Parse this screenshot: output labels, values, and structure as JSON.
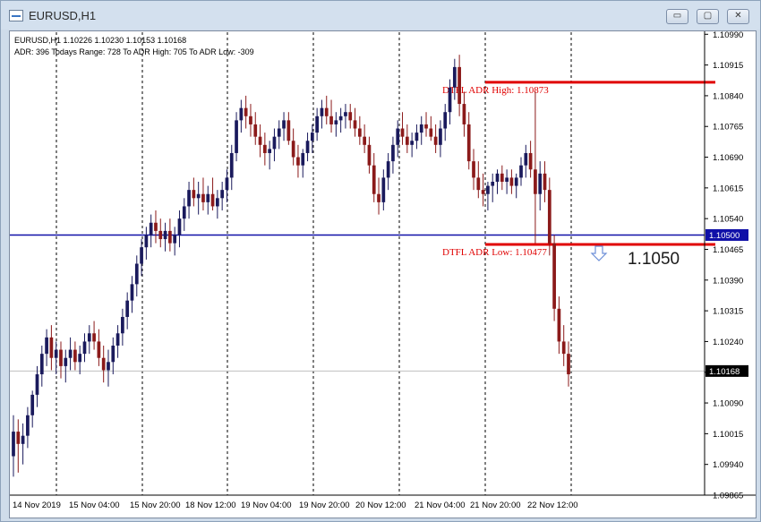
{
  "window": {
    "title": "EURUSD,H1",
    "buttons": {
      "minimize": "▭",
      "maximize": "▢",
      "close": "✕"
    }
  },
  "header": {
    "line1": "EURUSD,H1  1.10226 1.10230 1.10153 1.10168",
    "line2": "ADR: 396  Todays Range: 728  To ADR High: 705  To ADR Low: -309"
  },
  "annotations": {
    "adr_high_label": "DTFL ADR High: 1.10873",
    "adr_low_label": "DTFL ADR Low: 1.10477",
    "big_price": "1.1050"
  },
  "chart_data": {
    "type": "candlestick",
    "symbol": "EURUSD",
    "timeframe": "H1",
    "x_labels": [
      "14 Nov 2019",
      "15 Nov 04:00",
      "15 Nov 20:00",
      "18 Nov 12:00",
      "19 Nov 04:00",
      "19 Nov 20:00",
      "20 Nov 12:00",
      "21 Nov 04:00",
      "21 Nov 20:00",
      "22 Nov 12:00"
    ],
    "y_ticks": [
      1.09865,
      1.0994,
      1.10015,
      1.1009,
      1.10165,
      1.1024,
      1.10315,
      1.1039,
      1.10465,
      1.1054,
      1.10615,
      1.1069,
      1.10765,
      1.1084,
      1.10915,
      1.1099
    ],
    "ylim": [
      1.09865,
      1.10995
    ],
    "ohlc": [
      [
        1.0996,
        1.1006,
        1.0991,
        1.1002
      ],
      [
        1.1002,
        1.1005,
        1.0992,
        1.0999
      ],
      [
        1.0999,
        1.1004,
        1.0994,
        1.1001
      ],
      [
        1.1001,
        1.1008,
        1.0998,
        1.1006
      ],
      [
        1.1006,
        1.1012,
        1.1003,
        1.1011
      ],
      [
        1.1011,
        1.1018,
        1.1008,
        1.1016
      ],
      [
        1.1016,
        1.1023,
        1.1013,
        1.1021
      ],
      [
        1.1021,
        1.1027,
        1.1018,
        1.1025
      ],
      [
        1.1025,
        1.1028,
        1.1017,
        1.102
      ],
      [
        1.102,
        1.1024,
        1.1016,
        1.1022
      ],
      [
        1.1022,
        1.1024,
        1.1015,
        1.1018
      ],
      [
        1.1018,
        1.1022,
        1.1014,
        1.102
      ],
      [
        1.102,
        1.1025,
        1.1017,
        1.1022
      ],
      [
        1.1022,
        1.1024,
        1.1017,
        1.1019
      ],
      [
        1.1019,
        1.1023,
        1.1016,
        1.1021
      ],
      [
        1.1021,
        1.1026,
        1.1019,
        1.1024
      ],
      [
        1.1024,
        1.1028,
        1.1021,
        1.1026
      ],
      [
        1.1026,
        1.1029,
        1.1022,
        1.1024
      ],
      [
        1.1024,
        1.1027,
        1.1018,
        1.102
      ],
      [
        1.102,
        1.1023,
        1.1014,
        1.1017
      ],
      [
        1.1017,
        1.1022,
        1.1013,
        1.1019
      ],
      [
        1.1019,
        1.1025,
        1.1016,
        1.1023
      ],
      [
        1.1023,
        1.1028,
        1.102,
        1.1026
      ],
      [
        1.1026,
        1.1032,
        1.1023,
        1.103
      ],
      [
        1.103,
        1.1036,
        1.1027,
        1.1034
      ],
      [
        1.1034,
        1.104,
        1.1031,
        1.1038
      ],
      [
        1.1038,
        1.1045,
        1.1035,
        1.1043
      ],
      [
        1.1043,
        1.1049,
        1.104,
        1.1047
      ],
      [
        1.1047,
        1.1052,
        1.1044,
        1.105
      ],
      [
        1.105,
        1.1055,
        1.1047,
        1.1053
      ],
      [
        1.1053,
        1.1056,
        1.1048,
        1.1051
      ],
      [
        1.1051,
        1.1054,
        1.1047,
        1.1049
      ],
      [
        1.1049,
        1.1053,
        1.1046,
        1.1051
      ],
      [
        1.1051,
        1.1054,
        1.1046,
        1.1048
      ],
      [
        1.1048,
        1.1052,
        1.1045,
        1.105
      ],
      [
        1.105,
        1.1056,
        1.1047,
        1.1054
      ],
      [
        1.1054,
        1.1059,
        1.1051,
        1.1057
      ],
      [
        1.1057,
        1.1063,
        1.1054,
        1.1061
      ],
      [
        1.1061,
        1.1064,
        1.1057,
        1.1059
      ],
      [
        1.1059,
        1.1063,
        1.1055,
        1.106
      ],
      [
        1.106,
        1.1064,
        1.1056,
        1.1058
      ],
      [
        1.1058,
        1.1062,
        1.1055,
        1.106
      ],
      [
        1.106,
        1.1064,
        1.1056,
        1.1057
      ],
      [
        1.1057,
        1.1061,
        1.1054,
        1.1059
      ],
      [
        1.1059,
        1.1063,
        1.1056,
        1.1061
      ],
      [
        1.1061,
        1.1066,
        1.1058,
        1.1064
      ],
      [
        1.1064,
        1.1072,
        1.1061,
        1.107
      ],
      [
        1.107,
        1.108,
        1.1068,
        1.1078
      ],
      [
        1.1078,
        1.1083,
        1.1075,
        1.1081
      ],
      [
        1.1081,
        1.1084,
        1.1076,
        1.1079
      ],
      [
        1.1079,
        1.1082,
        1.1074,
        1.1077
      ],
      [
        1.1077,
        1.108,
        1.1072,
        1.1074
      ],
      [
        1.1074,
        1.1077,
        1.1069,
        1.1072
      ],
      [
        1.1072,
        1.1075,
        1.1067,
        1.107
      ],
      [
        1.107,
        1.1073,
        1.1066,
        1.1071
      ],
      [
        1.1071,
        1.1076,
        1.1068,
        1.1074
      ],
      [
        1.1074,
        1.1078,
        1.1071,
        1.1076
      ],
      [
        1.1076,
        1.108,
        1.1073,
        1.1078
      ],
      [
        1.1078,
        1.108,
        1.1072,
        1.1073
      ],
      [
        1.1073,
        1.1076,
        1.1067,
        1.1069
      ],
      [
        1.1069,
        1.1072,
        1.1064,
        1.1067
      ],
      [
        1.1067,
        1.1071,
        1.1064,
        1.107
      ],
      [
        1.107,
        1.1075,
        1.1068,
        1.1073
      ],
      [
        1.1073,
        1.1077,
        1.107,
        1.1075
      ],
      [
        1.1075,
        1.1081,
        1.1073,
        1.1079
      ],
      [
        1.1079,
        1.1083,
        1.1076,
        1.1081
      ],
      [
        1.1081,
        1.1084,
        1.1077,
        1.1079
      ],
      [
        1.1079,
        1.1083,
        1.1075,
        1.1077
      ],
      [
        1.1077,
        1.108,
        1.1074,
        1.1078
      ],
      [
        1.1078,
        1.1081,
        1.1075,
        1.1079
      ],
      [
        1.1079,
        1.1082,
        1.1076,
        1.108
      ],
      [
        1.108,
        1.1082,
        1.1076,
        1.1078
      ],
      [
        1.1078,
        1.1081,
        1.1074,
        1.1076
      ],
      [
        1.1076,
        1.1079,
        1.1072,
        1.1074
      ],
      [
        1.1074,
        1.1077,
        1.107,
        1.1072
      ],
      [
        1.1072,
        1.1074,
        1.1065,
        1.1067
      ],
      [
        1.1067,
        1.107,
        1.1058,
        1.106
      ],
      [
        1.106,
        1.1064,
        1.1055,
        1.1058
      ],
      [
        1.1058,
        1.1066,
        1.1056,
        1.1064
      ],
      [
        1.1064,
        1.107,
        1.1061,
        1.1068
      ],
      [
        1.1068,
        1.1074,
        1.1065,
        1.1072
      ],
      [
        1.1072,
        1.1078,
        1.1069,
        1.1076
      ],
      [
        1.1076,
        1.108,
        1.1072,
        1.1074
      ],
      [
        1.1074,
        1.1077,
        1.107,
        1.1072
      ],
      [
        1.1072,
        1.1075,
        1.1069,
        1.1073
      ],
      [
        1.1073,
        1.1077,
        1.1071,
        1.1075
      ],
      [
        1.1075,
        1.1079,
        1.1072,
        1.1077
      ],
      [
        1.1077,
        1.108,
        1.1074,
        1.1076
      ],
      [
        1.1076,
        1.1079,
        1.1073,
        1.1074
      ],
      [
        1.1074,
        1.1077,
        1.107,
        1.1072
      ],
      [
        1.1072,
        1.1078,
        1.1069,
        1.1076
      ],
      [
        1.1076,
        1.1082,
        1.1073,
        1.108
      ],
      [
        1.108,
        1.1088,
        1.1077,
        1.1086
      ],
      [
        1.1086,
        1.1093,
        1.1083,
        1.1091
      ],
      [
        1.1091,
        1.1094,
        1.1079,
        1.1082
      ],
      [
        1.1082,
        1.1085,
        1.1074,
        1.1077
      ],
      [
        1.1077,
        1.108,
        1.1066,
        1.1068
      ],
      [
        1.1068,
        1.1071,
        1.1061,
        1.1064
      ],
      [
        1.1064,
        1.1068,
        1.1059,
        1.1061
      ],
      [
        1.1061,
        1.1065,
        1.1057,
        1.106
      ],
      [
        1.106,
        1.1063,
        1.1056,
        1.1062
      ],
      [
        1.1062,
        1.1065,
        1.1058,
        1.1063
      ],
      [
        1.1063,
        1.1066,
        1.106,
        1.1065
      ],
      [
        1.1065,
        1.1067,
        1.1061,
        1.1063
      ],
      [
        1.1063,
        1.1066,
        1.106,
        1.1064
      ],
      [
        1.1064,
        1.1066,
        1.106,
        1.1062
      ],
      [
        1.1062,
        1.1065,
        1.1059,
        1.1064
      ],
      [
        1.1064,
        1.1069,
        1.1062,
        1.1067
      ],
      [
        1.1067,
        1.1072,
        1.1064,
        1.107
      ],
      [
        1.107,
        1.1073,
        1.1064,
        1.1066
      ],
      [
        1.1066,
        1.1085,
        1.1048,
        1.106
      ],
      [
        1.106,
        1.1068,
        1.1056,
        1.1065
      ],
      [
        1.1065,
        1.1068,
        1.1058,
        1.1061
      ],
      [
        1.1061,
        1.1064,
        1.1045,
        1.1048
      ],
      [
        1.1048,
        1.105,
        1.1029,
        1.1032
      ],
      [
        1.1032,
        1.1035,
        1.1021,
        1.1024
      ],
      [
        1.1024,
        1.1028,
        1.1018,
        1.1021
      ],
      [
        1.1021,
        1.1024,
        1.1013,
        1.1016
      ]
    ],
    "horizontal_lines": [
      {
        "name": "DTFL ADR High",
        "value": 1.10873,
        "color": "#e00000"
      },
      {
        "name": "DTFL ADR Low",
        "value": 1.10477,
        "color": "#e00000"
      },
      {
        "name": "level",
        "value": 1.105,
        "color": "#1010a8"
      },
      {
        "name": "bid",
        "value": 1.10168,
        "color": "#c0c0c0"
      }
    ],
    "price_tags": [
      "1.10500",
      "1.10168"
    ],
    "colors": {
      "bull": "#1a1a5c",
      "bear": "#8b1a1a",
      "adr": "#e00000",
      "level": "#1010a8",
      "arrow": "#6d8fd8"
    }
  }
}
